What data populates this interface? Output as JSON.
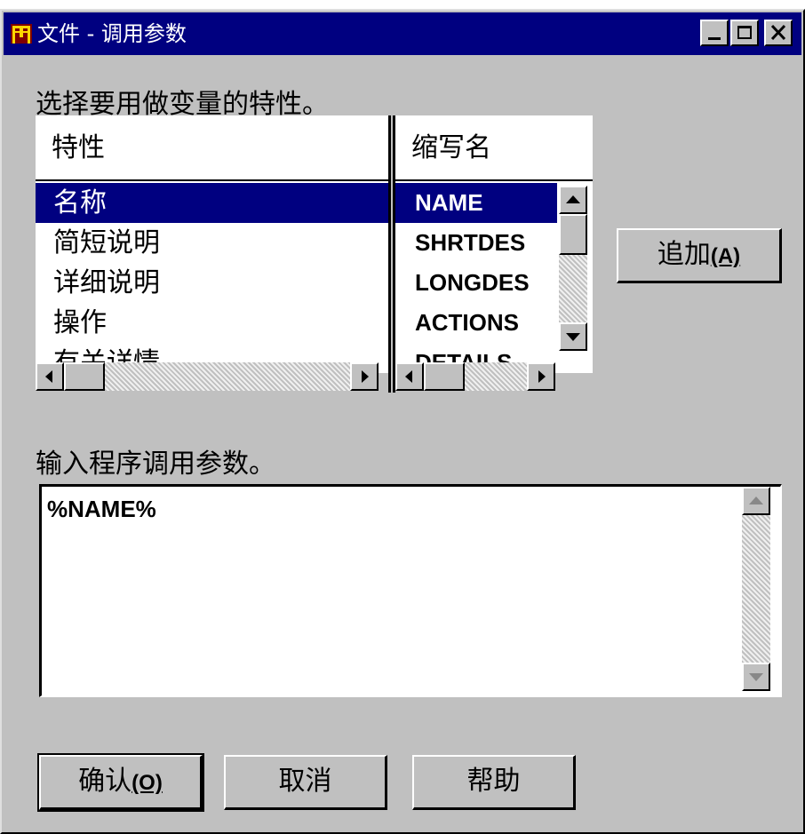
{
  "window": {
    "title": "文件 - 调用参数",
    "icon": "app-window-icon",
    "controls": [
      "minimize-icon",
      "maximize-icon",
      "close-icon"
    ]
  },
  "attributes": {
    "prompt": "选择要用做变量的特性。",
    "column_header": "特性",
    "items": [
      "名称",
      "简短说明",
      "详细说明",
      "操作",
      "有关详情"
    ],
    "selected_index": 0
  },
  "abbreviations": {
    "column_header": "缩写名",
    "items": [
      "NAME",
      "SHRTDES",
      "LONGDES",
      "ACTIONS",
      "DETAILS"
    ],
    "selected_index": 0
  },
  "add_button": {
    "label": "追加",
    "mnemonic": "(A)"
  },
  "params": {
    "prompt": "输入程序调用参数。",
    "value": "%NAME%"
  },
  "buttons": {
    "ok_label": "确认",
    "ok_mnemonic": "(O)",
    "cancel_label": "取消",
    "help_label": "帮助"
  },
  "colors": {
    "face": "#c0c0c0",
    "title_bar": "#000080",
    "selection": "#000080"
  }
}
